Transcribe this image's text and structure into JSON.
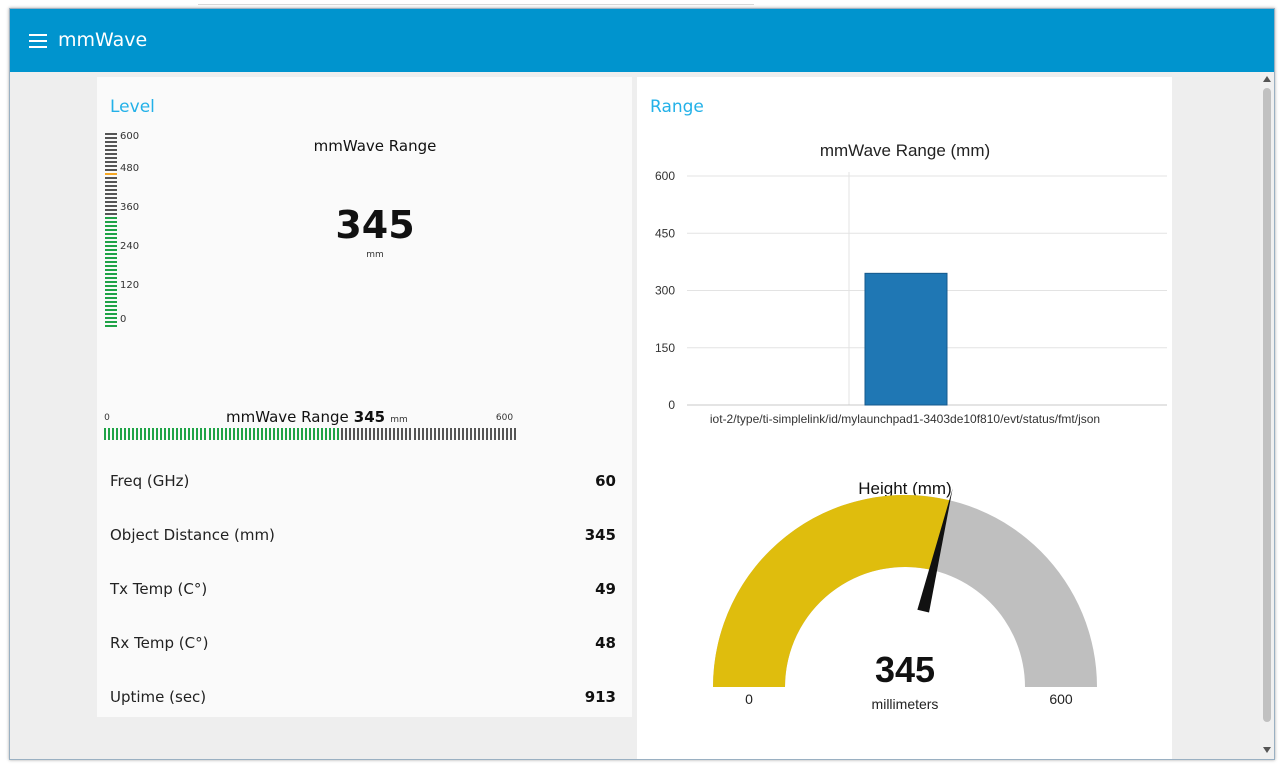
{
  "app": {
    "title": "mmWave"
  },
  "level_card": {
    "title": "Level",
    "vertical_gauge": {
      "title": "mmWave Range",
      "value": "345",
      "unit": "mm",
      "ticks": [
        "600",
        "480",
        "360",
        "240",
        "120",
        "0"
      ],
      "fraction": 0.575
    },
    "horizontal_gauge": {
      "title": "mmWave Range",
      "value": "345",
      "unit": "mm",
      "min": "0",
      "max": "600",
      "fraction": 0.575
    },
    "rows": [
      {
        "label": "Freq (GHz)",
        "value": "60"
      },
      {
        "label": "Object Distance (mm)",
        "value": "345"
      },
      {
        "label": "Tx Temp (C°)",
        "value": "49"
      },
      {
        "label": "Rx Temp (C°)",
        "value": "48"
      },
      {
        "label": "Uptime (sec)",
        "value": "913"
      }
    ]
  },
  "range_card": {
    "title": "Range",
    "gauge": {
      "title": "Height (mm)",
      "value": "345",
      "unit": "millimeters",
      "min": "0",
      "max": "600",
      "fraction": 0.575,
      "color": "#dfbd0d"
    }
  },
  "chart_data": {
    "type": "bar",
    "title": "mmWave Range (mm)",
    "categories": [
      "iot-2/type/ti-simplelink/id/mylaunchpad1-3403de10f810/evt/status/fmt/json"
    ],
    "values": [
      345
    ],
    "yticks": [
      "600",
      "450",
      "300",
      "150",
      "0"
    ],
    "ylim": [
      0,
      600
    ],
    "grid": true,
    "color": "#1f77b4"
  },
  "colors": {
    "toolbar": "#0094ce",
    "accent": "#23b1e8",
    "level_on": "#1fa347",
    "level_mark": "#f5a623",
    "level_off": "#555555"
  }
}
